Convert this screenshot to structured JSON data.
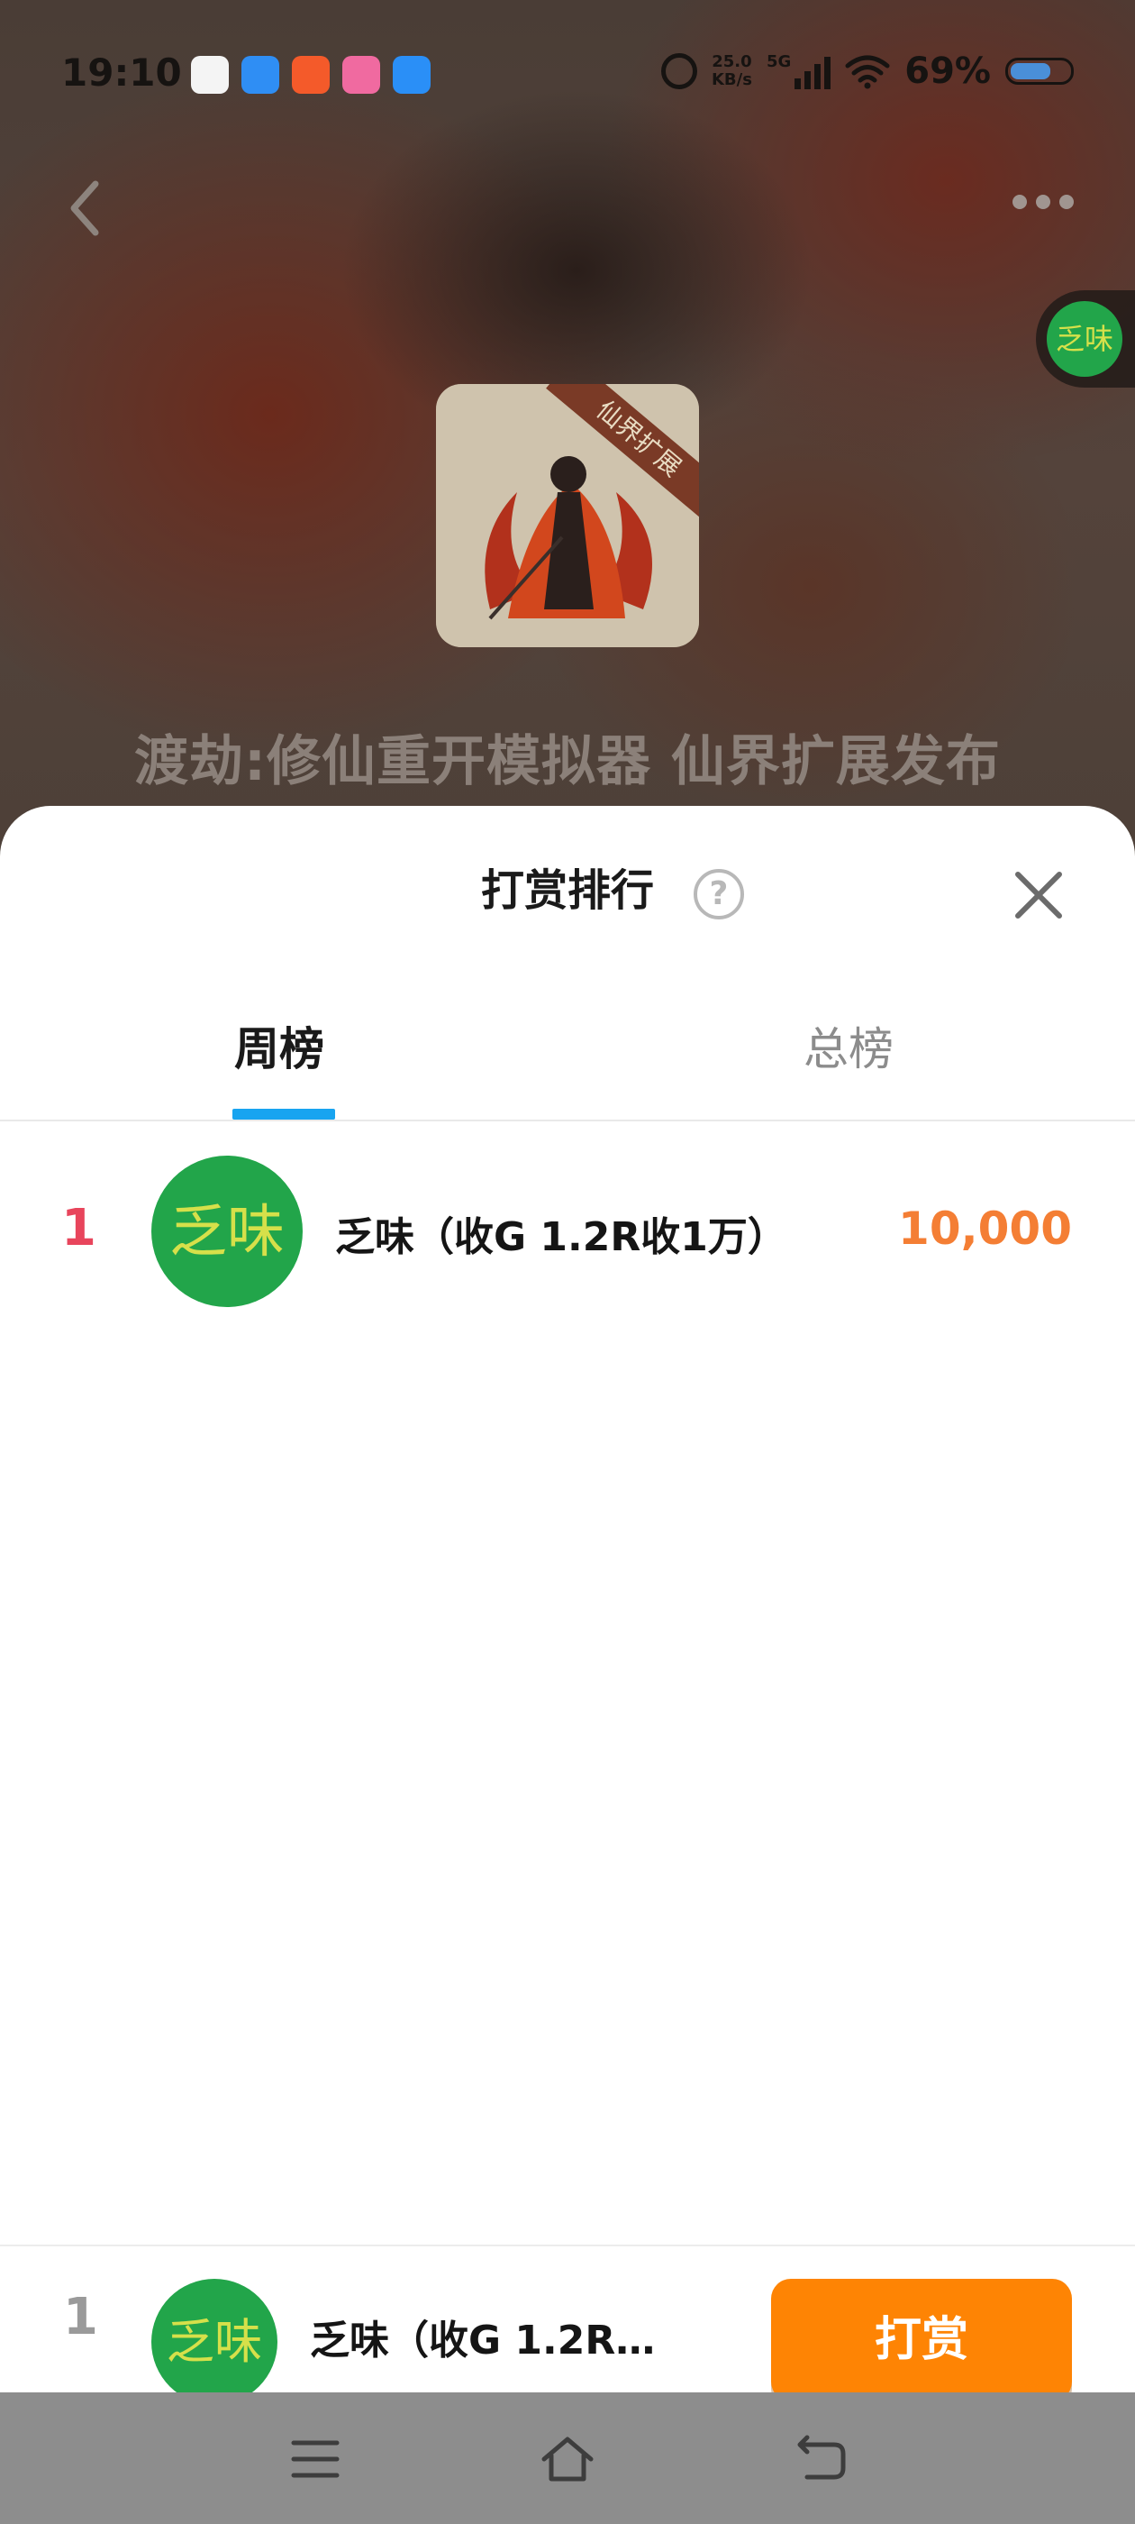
{
  "status_bar": {
    "time": "19:10",
    "net_speed_value": "25.0",
    "net_speed_unit": "KB/s",
    "network_type": "5G",
    "battery_percent": "69%",
    "battery_level": 0.69,
    "notification_icons": [
      "qq-icon",
      "browser-icon",
      "app-store-icon",
      "bilibili-icon",
      "message-icon"
    ]
  },
  "header": {
    "back_icon": "chevron-left-icon",
    "more_icon": "more-dots-icon"
  },
  "game": {
    "title": "渡劫:修仙重开模拟器 仙界扩展发布",
    "icon_ribbon_text": "仙界扩展"
  },
  "sheet": {
    "title": "打赏排行",
    "help_icon": "?",
    "close_icon": "close-icon",
    "tabs": [
      {
        "label": "周榜",
        "active": true
      },
      {
        "label": "总榜",
        "active": false
      }
    ]
  },
  "rankings": [
    {
      "rank": "1",
      "name": "乏味（收G 1.2R收1万）",
      "amount": "10,000",
      "avatar_text": "乏味"
    }
  ],
  "my_rank": {
    "rank": "1",
    "name": "乏味（收G 1.2R收1万）",
    "avatar_text": "乏味"
  },
  "tip_button": {
    "label": "打赏"
  },
  "colors": {
    "accent_blue": "#18a4f0",
    "tip_orange": "#fe8404",
    "amount_orange": "#f47e34",
    "rank_red": "#e8455c",
    "avatar_green": "#22a54a"
  }
}
